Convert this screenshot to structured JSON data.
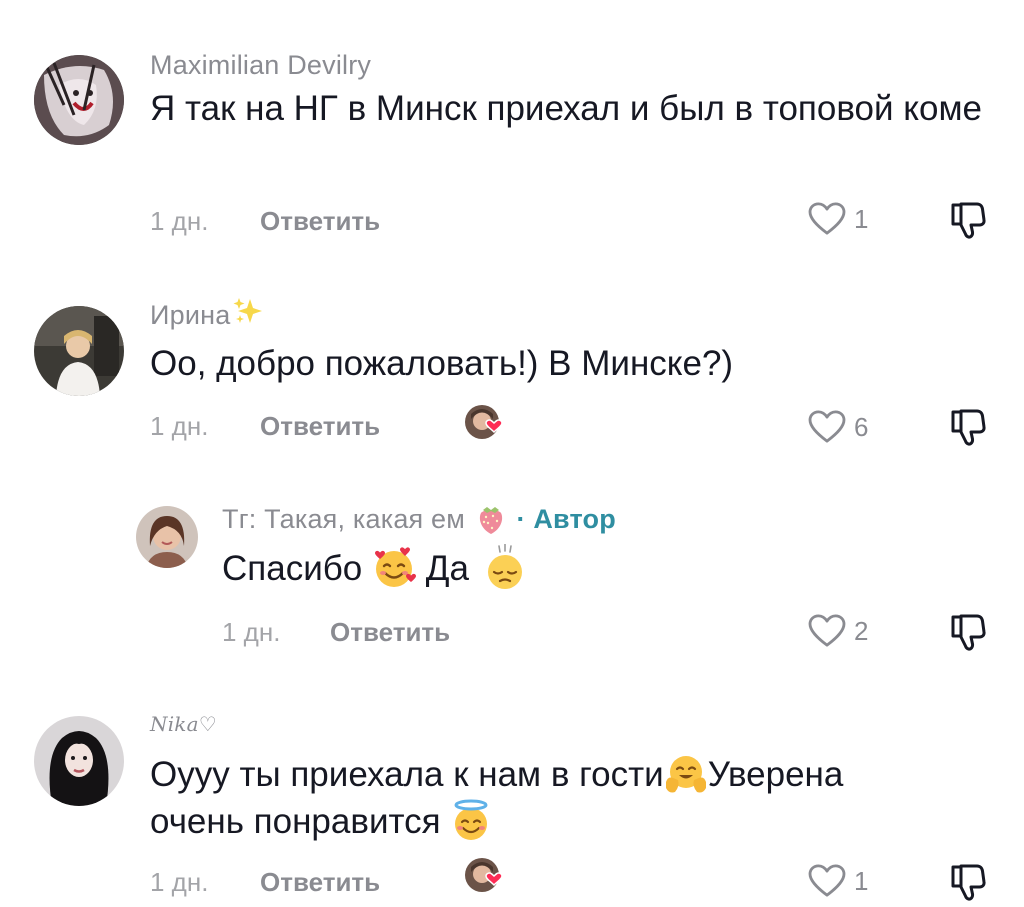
{
  "comments": [
    {
      "username": "Maximilian Devilry",
      "text": "Я так на НГ в Минск приехал и был в топовой коме",
      "age": "1 дн.",
      "reply_label": "Ответить",
      "likes": "1",
      "creator_liked": false
    },
    {
      "username": "Ирина",
      "text": "Оо, добро пожаловать!) В Минске?)",
      "age": "1 дн.",
      "reply_label": "Ответить",
      "likes": "6",
      "creator_liked": true
    },
    {
      "username": "Тг: Такая, какая ем",
      "author_badge": "· Автор",
      "text_part1": "Спасибо",
      "text_part2": "Да",
      "age": "1 дн.",
      "reply_label": "Ответить",
      "likes": "2",
      "creator_liked": false
    },
    {
      "username": "Nika♡",
      "text_part1": "Оууу ты приехала к нам в гости",
      "text_part2": "Уверена",
      "text_part3": "очень понравится",
      "age": "1 дн.",
      "reply_label": "Ответить",
      "likes": "1",
      "creator_liked": true
    }
  ],
  "colors": {
    "text": "#161823",
    "secondary": "#8a8b91",
    "author_badge": "#2f8ea1",
    "heart_badge": "#fe2c55"
  },
  "icons": [
    "heart-outline-icon",
    "dislike-icon",
    "sparkles-emoji",
    "strawberry-emoji",
    "smiling-face-with-hearts-emoji",
    "pensive-face-emoji",
    "hugging-face-emoji",
    "smiling-face-with-halo-emoji"
  ]
}
